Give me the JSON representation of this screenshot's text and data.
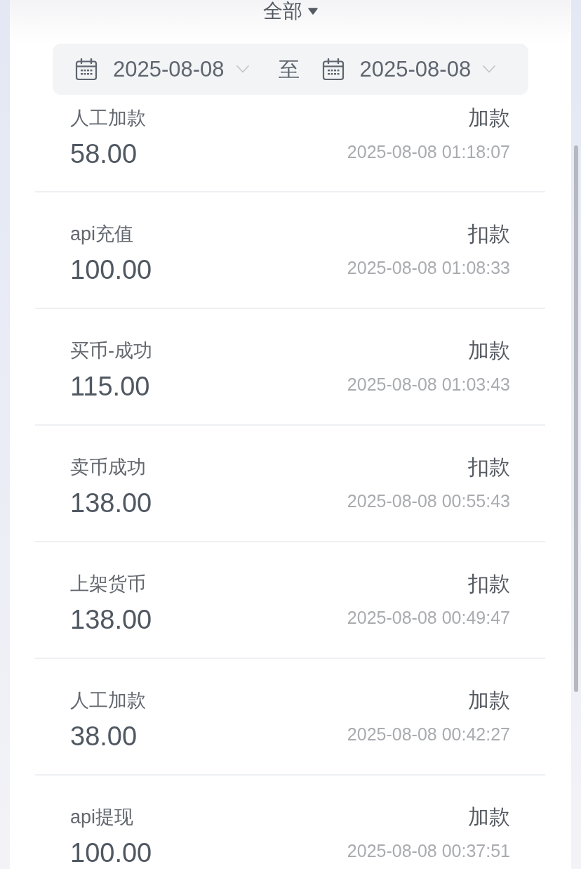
{
  "filter": {
    "label": "全部"
  },
  "date_range": {
    "start": "2025-08-08",
    "separator": "至",
    "end": "2025-08-08"
  },
  "records": [
    {
      "title": "人工加款",
      "amount": "58.00",
      "type": "加款",
      "time": "2025-08-08 01:18:07"
    },
    {
      "title": "api充值",
      "amount": "100.00",
      "type": "扣款",
      "time": "2025-08-08 01:08:33"
    },
    {
      "title": "买币-成功",
      "amount": "115.00",
      "type": "加款",
      "time": "2025-08-08 01:03:43"
    },
    {
      "title": "卖币成功",
      "amount": "138.00",
      "type": "扣款",
      "time": "2025-08-08 00:55:43"
    },
    {
      "title": "上架货币",
      "amount": "138.00",
      "type": "扣款",
      "time": "2025-08-08 00:49:47"
    },
    {
      "title": "人工加款",
      "amount": "38.00",
      "type": "加款",
      "time": "2025-08-08 00:42:27"
    },
    {
      "title": "api提现",
      "amount": "100.00",
      "type": "加款",
      "time": "2025-08-08 00:37:51"
    }
  ]
}
